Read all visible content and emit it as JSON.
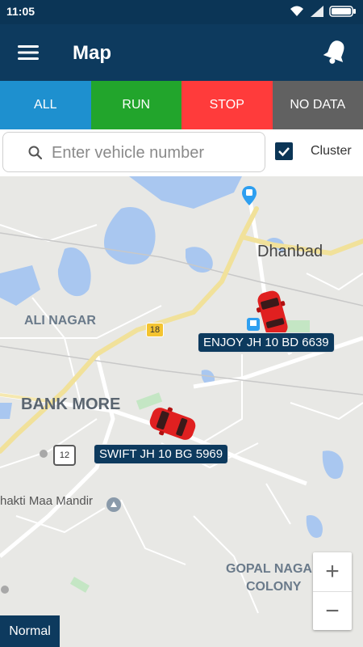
{
  "status_bar": {
    "time": "11:05"
  },
  "app_bar": {
    "title": "Map",
    "menu_icon": "hamburger-menu-icon",
    "notification_icon": "bell-icon"
  },
  "filter_tabs": [
    {
      "label": "ALL",
      "color": "#1e90cf"
    },
    {
      "label": "RUN",
      "color": "#22a52c"
    },
    {
      "label": "STOP",
      "color": "#ff3b3b"
    },
    {
      "label": "NO DATA",
      "color": "#616161"
    }
  ],
  "search": {
    "placeholder": "Enter vehicle number",
    "value": ""
  },
  "cluster": {
    "label": "Cluster",
    "checked": true
  },
  "map": {
    "places": [
      "Dhanbad",
      "ALI NAGAR",
      "BANK MORE",
      "GOPAL NAGAR",
      "COLONY"
    ],
    "pois": [
      "hakti Maa Mandir"
    ],
    "road_shields": [
      "18",
      "12"
    ],
    "vehicles": [
      {
        "label": "ENJOY JH 10 BD 6639",
        "status": "stop",
        "color": "#e02020"
      },
      {
        "label": "SWIFT JH 10 BG 5969",
        "status": "stop",
        "color": "#e02020"
      }
    ]
  },
  "zoom": {
    "in_label": "+",
    "out_label": "−"
  },
  "map_type": {
    "label": "Normal"
  }
}
